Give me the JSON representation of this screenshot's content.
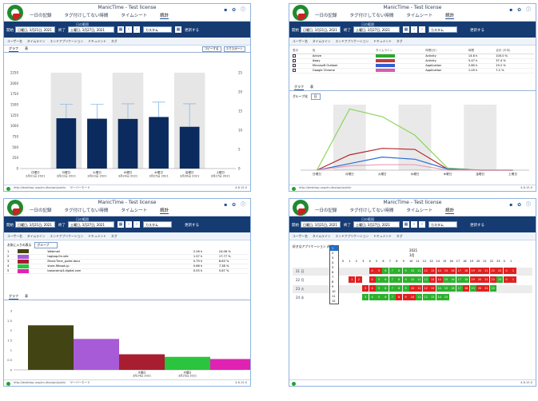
{
  "app_title": "ManicTime - Test license",
  "nav_tabs": [
    "一日の記録",
    "タグ付けしてない時間",
    "タイムシート",
    "統計"
  ],
  "date_range": {
    "caption": "日の範囲",
    "from_label": "開始",
    "from_value": "日曜日, 3月21日, 2021",
    "to_label": "終了",
    "to_value": "土曜日, 3月27日, 2021",
    "preset": "カスタム",
    "refresh_label": "更新する"
  },
  "filters": [
    "ユーザー名",
    "タイムライン",
    "エンドアプリケーション",
    "ドキュメント",
    "タグ"
  ],
  "tabs": {
    "chart": "グラフ",
    "table": "表",
    "copy": "コピーする",
    "export": "エクスポート"
  },
  "status": {
    "url": "http://desktop-usp/en-dbx/api/public",
    "state": "サーバーモード",
    "version": "4.6.15.0"
  },
  "panel1_chart": {
    "type": "bar",
    "categories": [
      "日曜日\n3月21日 2021",
      "月曜日\n3月22日 2021",
      "火曜日\n3月23日 2021",
      "水曜日\n3月24日 2021",
      "木曜日\n3月25日 2021",
      "金曜日\n3月26日 2021",
      "土曜日\n3月27日 2021"
    ],
    "values": [
      0,
      1180,
      1170,
      1165,
      1210,
      980,
      0
    ],
    "error_high": [
      0,
      1510,
      1510,
      1520,
      1560,
      1520,
      0
    ],
    "error_low": [
      0,
      0,
      0,
      0,
      0,
      0,
      0
    ],
    "left_ticks": [
      "0",
      "250",
      "500",
      "750",
      "1000",
      "1250",
      "1500",
      "1750",
      "2000",
      "2250"
    ],
    "right_ticks": [
      "0",
      "5",
      "10",
      "15",
      "20",
      "25"
    ],
    "bar_color": "#0b2a5e",
    "shade_color": "#e6e6e6"
  },
  "panel2": {
    "columns": [
      "表示",
      "色",
      "タイムライン",
      "時間(分)",
      "時間",
      "合計 (平均)"
    ],
    "rows": [
      {
        "name": "Active",
        "color": "#2aa82a",
        "kind": "Activity",
        "value": "14.6 h",
        "pct": "100.0 %"
      },
      {
        "name": "Away",
        "color": "#c23b3b",
        "kind": "Activity",
        "value": "5.47 h",
        "pct": "37.4 %"
      },
      {
        "name": "Microsoft Outlook",
        "color": "#2f5fd1",
        "kind": "Application",
        "value": "2.80 h",
        "pct": "19.2 %"
      },
      {
        "name": "Google Chrome",
        "color": "#d45bb0",
        "kind": "Application",
        "value": "1.05 h",
        "pct": "7.2 %"
      }
    ],
    "chart": {
      "type": "line",
      "categories": [
        "日曜日",
        "月曜日",
        "火曜日",
        "水曜日",
        "木曜日",
        "金曜日",
        "土曜日"
      ],
      "series": [
        {
          "name": "Active",
          "color": "#8bd65b",
          "values": [
            0,
            5.6,
            4.9,
            3.2,
            0.2,
            0,
            0
          ]
        },
        {
          "name": "Away",
          "color": "#b2282b",
          "values": [
            0,
            1.4,
            2.0,
            1.9,
            0.1,
            0,
            0
          ]
        },
        {
          "name": "Microsoft Outlook",
          "color": "#2f6ed1",
          "values": [
            0,
            0.6,
            1.2,
            1.0,
            0.1,
            0,
            0
          ]
        },
        {
          "name": "Google Chrome",
          "color": "#e8a0b8",
          "values": [
            0,
            0.4,
            0.5,
            0.5,
            0,
            0,
            0
          ]
        }
      ]
    },
    "group_label": "グループ化",
    "group_value": "日"
  },
  "panel3": {
    "group_label": "お気に入りの表示",
    "group_value": "グループ",
    "rows": [
      {
        "name": "Webmail",
        "color": "#434413",
        "value": "2.26 h",
        "pct": "24.06 %"
      },
      {
        "name": "tagbag.fm.site",
        "color": "#a85bd6",
        "value": "1.57 h",
        "pct": "17.77 %"
      },
      {
        "name": "ManicTime_guide.docx",
        "color": "#a81d30",
        "value": "0.79 h",
        "pct": "8.83 %"
      },
      {
        "name": "store.fitbook.jp",
        "color": "#2bc43e",
        "value": "0.66 h",
        "pct": "7.38 %"
      },
      {
        "name": "basecamp3.digital.com",
        "color": "#e022b3",
        "value": "0.55 h",
        "pct": "5.67 %"
      }
    ],
    "chart": {
      "type": "bar",
      "categories": [
        "",
        "",
        "水曜日\n3月24日 2021",
        "木曜日\n3月25日 2021",
        ""
      ],
      "values": [
        2.26,
        1.57,
        0.79,
        0.66,
        0.55
      ],
      "colors": [
        "#434413",
        "#a85bd6",
        "#a81d30",
        "#2bc43e",
        "#e022b3"
      ],
      "yticks": [
        "0",
        "0.5",
        "1",
        "1.5",
        "2",
        "2.5",
        "3"
      ]
    }
  },
  "panel4": {
    "heading": "好きなアプリケーション (時間)",
    "year": "2021",
    "month": "3月",
    "dropdown": [
      "1",
      "2",
      "3",
      "4",
      "5",
      "6",
      "7",
      "8",
      "9",
      "10",
      "11",
      "12"
    ],
    "dropdown_selected": "1",
    "days": [
      "21 日",
      "22 月",
      "23 火",
      "24 水"
    ],
    "green": "#2db12d",
    "red": "#e02020"
  }
}
